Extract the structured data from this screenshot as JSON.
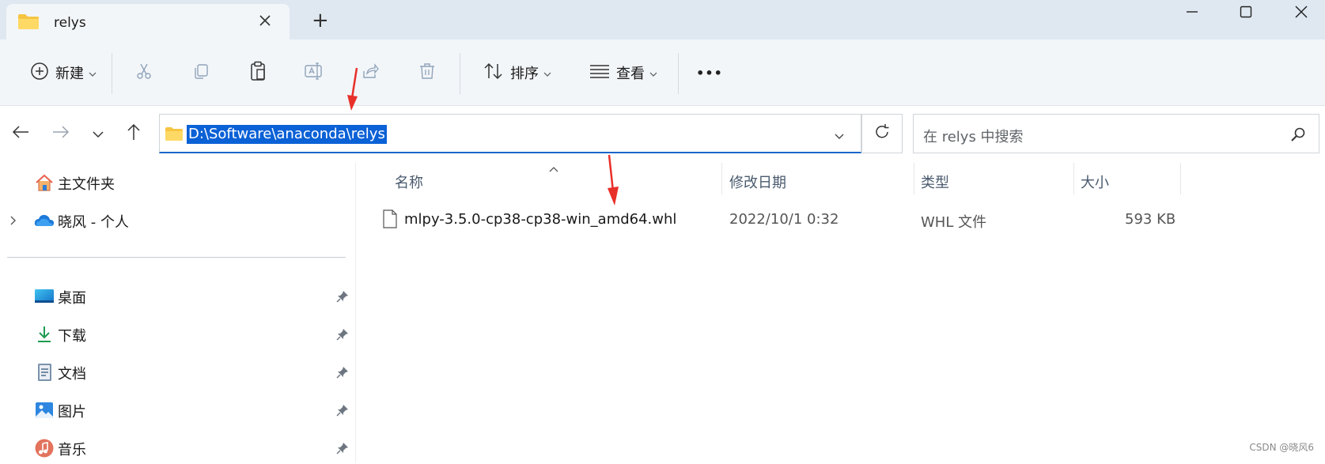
{
  "window": {
    "tab_title": "relys",
    "new_tab_label": "+",
    "icons": [
      "folder-icon",
      "close-tab-icon",
      "minimize-icon",
      "maximize-icon",
      "close-window-icon"
    ]
  },
  "toolbar": {
    "new_label": "新建",
    "sort_label": "排序",
    "view_label": "查看",
    "more_label": "•••"
  },
  "address": {
    "path": "D:\\Software\\anaconda\\relys",
    "search_placeholder": "在 relys 中搜索"
  },
  "sidebar": {
    "items": [
      {
        "label": "主文件夹",
        "icon": "home-icon"
      },
      {
        "label": "晓风 - 个人",
        "icon": "onedrive-cloud-icon"
      },
      {
        "label": "桌面",
        "icon": "desktop-icon"
      },
      {
        "label": "下载",
        "icon": "download-icon"
      },
      {
        "label": "文档",
        "icon": "document-icon"
      },
      {
        "label": "图片",
        "icon": "pictures-icon"
      },
      {
        "label": "音乐",
        "icon": "music-icon"
      }
    ]
  },
  "file_list": {
    "columns": [
      "名称",
      "修改日期",
      "类型",
      "大小"
    ],
    "rows": [
      {
        "name": "mlpy-3.5.0-cp38-cp38-win_amd64.whl",
        "modified": "2022/10/1 0:32",
        "type": "WHL 文件",
        "size": "593 KB"
      }
    ]
  },
  "watermark": "CSDN @晓风6",
  "colors": {
    "accent": "#0b61d6",
    "annotation_arrow": "#e8302a",
    "tab_bar": "#dfe8f1",
    "toolbar": "#f3f6f9"
  }
}
